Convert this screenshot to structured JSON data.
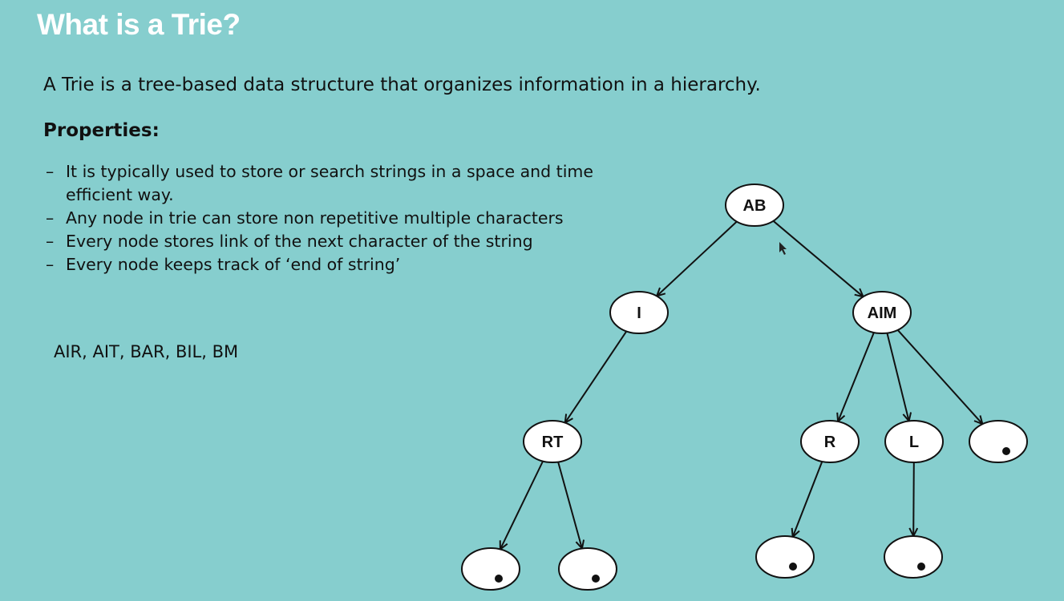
{
  "slide": {
    "title": "What is a Trie?",
    "intro": "A Trie is a tree-based data structure that organizes information in a hierarchy.",
    "properties_heading": "Properties:",
    "properties": [
      "It is typically used to store or search strings in a space and time efficient way.",
      "Any node in trie can store non repetitive multiple characters",
      "Every node stores link of the next character of the string",
      "Every node keeps track of ‘end of string’"
    ],
    "example_words": "AIR, AIT, BAR, BIL, BM"
  },
  "trie": {
    "nodes": [
      {
        "id": "root",
        "label": "AB"
      },
      {
        "id": "i",
        "label": "I"
      },
      {
        "id": "aim",
        "label": "AIM"
      },
      {
        "id": "rt",
        "label": "RT"
      },
      {
        "id": "r",
        "label": "R"
      },
      {
        "id": "l",
        "label": "L"
      },
      {
        "id": "end_aim",
        "label": "",
        "end_of_string": true
      },
      {
        "id": "end_rt_1",
        "label": "",
        "end_of_string": true
      },
      {
        "id": "end_rt_2",
        "label": "",
        "end_of_string": true
      },
      {
        "id": "end_r",
        "label": "",
        "end_of_string": true
      },
      {
        "id": "end_l",
        "label": "",
        "end_of_string": true
      }
    ],
    "edges": [
      {
        "from": "root",
        "to": "i"
      },
      {
        "from": "root",
        "to": "aim"
      },
      {
        "from": "i",
        "to": "rt"
      },
      {
        "from": "aim",
        "to": "r"
      },
      {
        "from": "aim",
        "to": "l"
      },
      {
        "from": "aim",
        "to": "end_aim"
      },
      {
        "from": "rt",
        "to": "end_rt_1"
      },
      {
        "from": "rt",
        "to": "end_rt_2"
      },
      {
        "from": "r",
        "to": "end_r"
      },
      {
        "from": "l",
        "to": "end_l"
      }
    ]
  },
  "colors": {
    "background": "#86cece",
    "title": "#ffffff",
    "text": "#111111",
    "node_fill": "#ffffff",
    "node_stroke": "#111111"
  },
  "icons": [
    "mouse-cursor-icon",
    "end-of-string-dot-icon",
    "arrowhead-icon"
  ]
}
